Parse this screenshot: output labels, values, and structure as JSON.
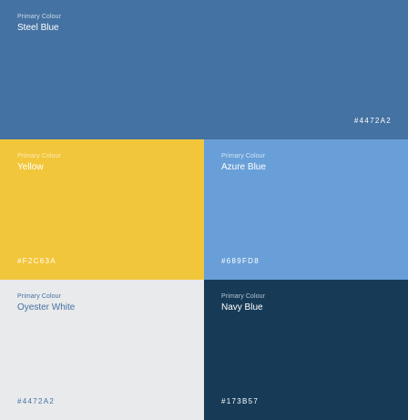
{
  "swatches": [
    {
      "label": "Primary Colour",
      "name": "Steel Blue",
      "hex": "#4472A2",
      "background": "#4472A2",
      "label_color": "#cdd9e8",
      "name_color": "#ffffff",
      "hex_color": "#ffffff"
    },
    {
      "label": "Primary Colour",
      "name": "Yellow",
      "hex": "#F2C63A",
      "background": "#F2C63A",
      "label_color": "#fbebb8",
      "name_color": "#ffffff",
      "hex_color": "#ffffff"
    },
    {
      "label": "Primary Colour",
      "name": "Azure Blue",
      "hex": "#689FD8",
      "background": "#689FD8",
      "label_color": "#d6e5f5",
      "name_color": "#ffffff",
      "hex_color": "#ffffff"
    },
    {
      "label": "Primary Colour",
      "name": "Oyester White",
      "hex": "#4472A2",
      "background": "#E9EAEC",
      "label_color": "#4472A2",
      "name_color": "#4472A2",
      "hex_color": "#4472A2"
    },
    {
      "label": "Primary Colour",
      "name": "Navy Blue",
      "hex": "#173B57",
      "background": "#173B57",
      "label_color": "#b9c5d0",
      "name_color": "#ffffff",
      "hex_color": "#ffffff"
    }
  ]
}
